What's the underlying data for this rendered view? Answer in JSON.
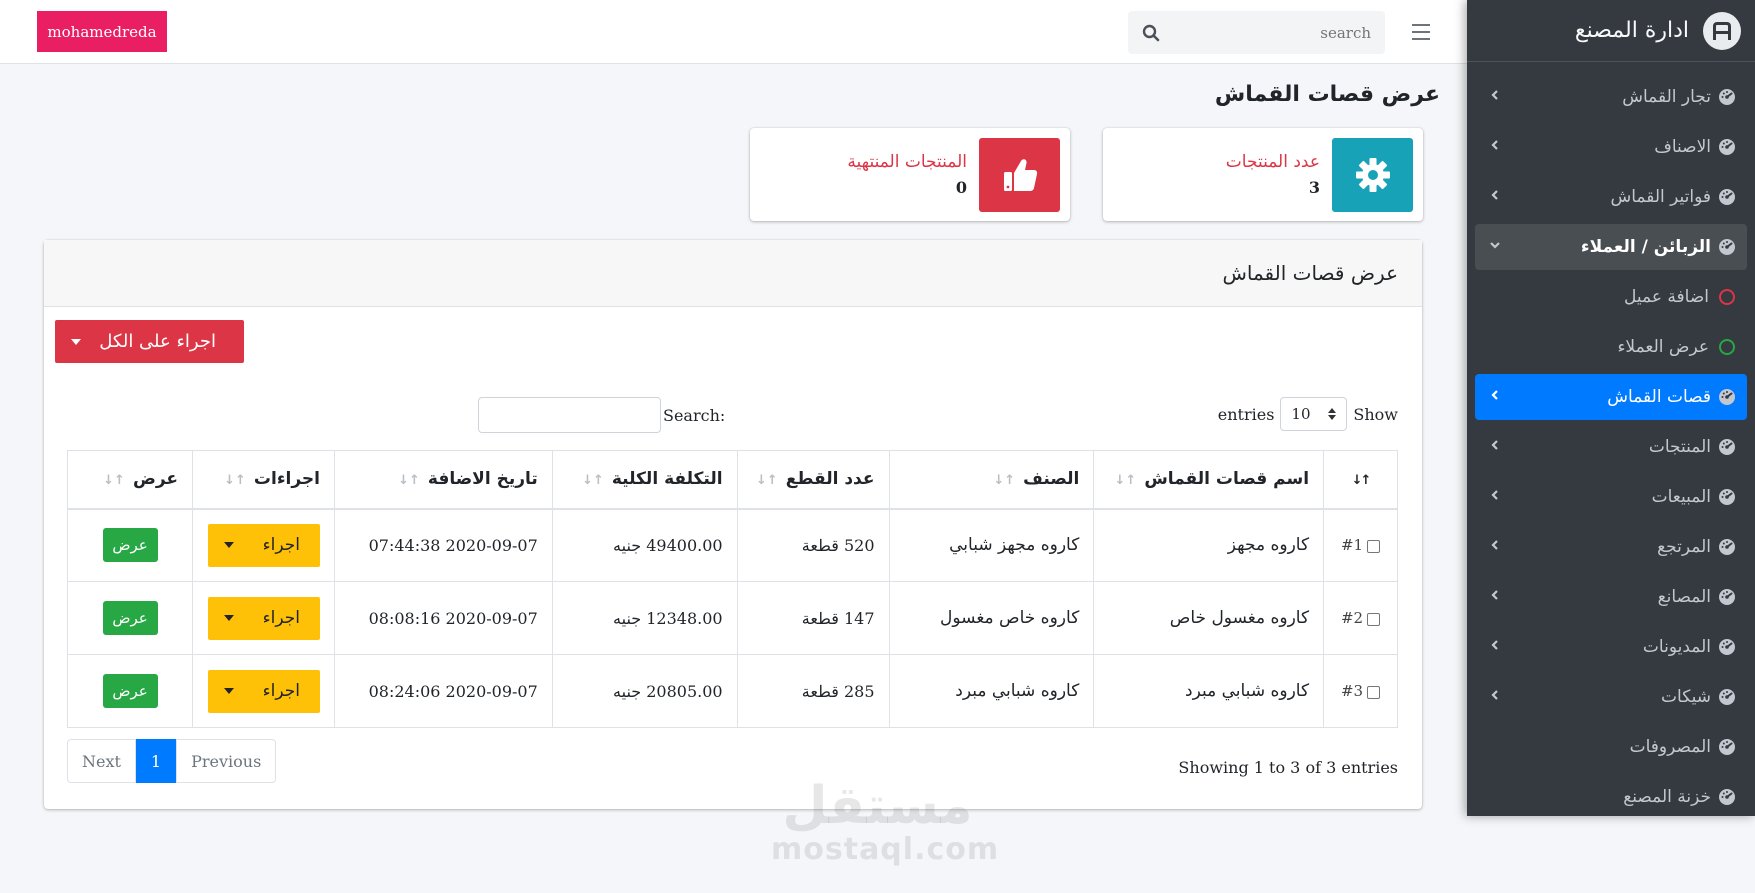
{
  "topbar": {
    "user": "mohamedreda",
    "search_placeholder": "search"
  },
  "sidebar": {
    "brand": "ادارة المصنع",
    "items": [
      {
        "label": "تجار القماش",
        "icon": "dashboard-icon",
        "chevron": "left"
      },
      {
        "label": "الاصناف",
        "icon": "dashboard-icon",
        "chevron": "left"
      },
      {
        "label": "فواتير القماش",
        "icon": "dashboard-icon",
        "chevron": "left"
      },
      {
        "label": "الزبائن / العملاء",
        "icon": "dashboard-icon",
        "chevron": "down",
        "state": "open"
      },
      {
        "label": "اضافة عميل",
        "icon": "circle-red-icon",
        "sub": true,
        "color": "#dc3545"
      },
      {
        "label": "عرض العملاء",
        "icon": "circle-green-icon",
        "sub": true,
        "color": "#28a745"
      },
      {
        "label": "قصات القماش",
        "icon": "dashboard-icon",
        "chevron": "left",
        "state": "active"
      },
      {
        "label": "المنتجات",
        "icon": "dashboard-icon",
        "chevron": "left"
      },
      {
        "label": "المبيعات",
        "icon": "dashboard-icon",
        "chevron": "left"
      },
      {
        "label": "المرتجع",
        "icon": "dashboard-icon",
        "chevron": "left"
      },
      {
        "label": "المصانع",
        "icon": "dashboard-icon",
        "chevron": "left"
      },
      {
        "label": "المديونات",
        "icon": "dashboard-icon",
        "chevron": "left"
      },
      {
        "label": "شيكات",
        "icon": "dashboard-icon",
        "chevron": "left"
      },
      {
        "label": "المصروفات",
        "icon": "dashboard-icon"
      },
      {
        "label": "خزنة المصنع",
        "icon": "dashboard-icon"
      }
    ]
  },
  "page": {
    "title": "عرض قصات القماش"
  },
  "stats": [
    {
      "label": "عدد المنتجات",
      "value": "3",
      "icon": "gear-icon",
      "color": "#17a2b8"
    },
    {
      "label": "المنتجات المنتهية",
      "value": "0",
      "icon": "thumbs-up-icon",
      "color": "#dc3545"
    }
  ],
  "card": {
    "title": "عرض قصات القماش",
    "bulk_action": "اجراء على الكل",
    "show_label": "Show",
    "entries_label": "entries",
    "entries_value": "10",
    "search_label": "Search:",
    "columns": [
      "اسم قصات القماش",
      "الصنف",
      "عدد القطع",
      "التكلفة الكلية",
      "تاريخ الاضافة",
      "اجراءات",
      "عرض"
    ],
    "rows": [
      {
        "id": "#1",
        "name": "كاروه مجهز",
        "category": "كاروه مجهز شبابي",
        "pieces": "520 قطعة",
        "cost": "49400.00 جنيه",
        "date": "2020-09-07 07:44:38",
        "action": "اجراء",
        "view": "عرض"
      },
      {
        "id": "#2",
        "name": "كاروه مغسول خاص",
        "category": "كاروه خاص مغسول",
        "pieces": "147 قطعة",
        "cost": "12348.00 جنيه",
        "date": "2020-09-07 08:08:16",
        "action": "اجراء",
        "view": "عرض"
      },
      {
        "id": "#3",
        "name": "كاروه شبابي مبرد",
        "category": "كاروه شبابي مبرد",
        "pieces": "285 قطعة",
        "cost": "20805.00 جنيه",
        "date": "2020-09-07 08:24:06",
        "action": "اجراء",
        "view": "عرض"
      }
    ],
    "showing": "Showing 1 to 3 of 3 entries",
    "pager": {
      "next": "Next",
      "current": "1",
      "previous": "Previous"
    }
  },
  "watermark": {
    "arabic": "مستقل",
    "latin": "mostaql.com"
  }
}
